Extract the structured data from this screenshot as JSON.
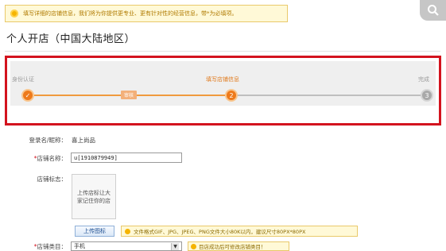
{
  "notice": {
    "text": "填写详细的店铺信息，我们将为你提供更专业、更有针对性的经营信息，带*为必填项。"
  },
  "page_title": "个人开店（中国大陆地区）",
  "progress": {
    "steps": [
      {
        "label": "身份认证",
        "marker": "✓",
        "status": "done"
      },
      {
        "label": "填写店铺信息",
        "marker": "2",
        "status": "current"
      },
      {
        "label": "完成",
        "marker": "3",
        "status": "todo"
      }
    ],
    "badge": "审核",
    "colors": {
      "active": "#ee7a1b",
      "line_done": "#f09a3e",
      "inactive": "#a9a9a9",
      "highlight_border": "#d3131e"
    }
  },
  "form": {
    "login_name": {
      "label": "登录名/昵称：",
      "value": "喜上尚品"
    },
    "shop_name": {
      "label_req": "*",
      "label": "店铺名称：",
      "value": "u[1910879949]"
    },
    "shop_logo": {
      "label": "店铺标志：",
      "placeholder": "上传店标让大家记住你的店"
    },
    "upload_button": "上传图标",
    "upload_hint": "文件格式GIF、JPG、JPEG、PNG文件大小80K以内，建议尺寸80PX*80PX",
    "category": {
      "label_req": "*",
      "label": "店铺类目：",
      "value": "手机",
      "hint": "目店成功后可修改店铺类目！"
    }
  }
}
